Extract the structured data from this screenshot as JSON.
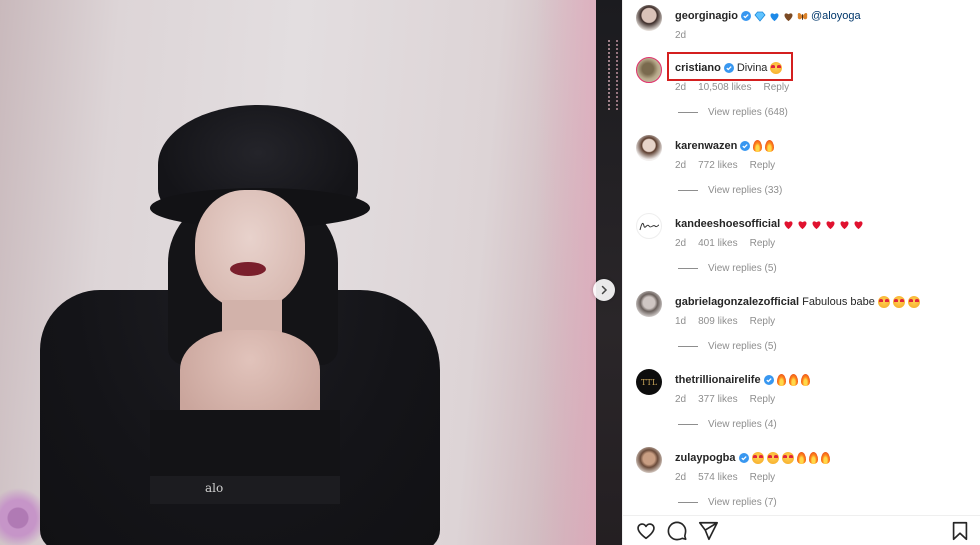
{
  "photo": {
    "logo_text": "alo"
  },
  "nav": {
    "next_icon": "chevron-right-icon"
  },
  "comments": [
    {
      "username": "georginagio",
      "verified": true,
      "text": "",
      "mention": "@aloyoga",
      "emoji": [
        "blue-diamond",
        "blue-heart",
        "brown-heart",
        "butterfly"
      ],
      "time": "2d",
      "likes": "",
      "reply_label": "",
      "view_replies": ""
    },
    {
      "username": "cristiano",
      "verified": true,
      "text": "Divina",
      "emoji": [
        "smiling-face-with-hearts"
      ],
      "time": "2d",
      "likes": "10,508 likes",
      "reply_label": "Reply",
      "view_replies": "View replies (648)",
      "highlighted": true
    },
    {
      "username": "karenwazen",
      "verified": true,
      "text": "",
      "emoji": [
        "fire",
        "fire"
      ],
      "time": "2d",
      "likes": "772 likes",
      "reply_label": "Reply",
      "view_replies": "View replies (33)"
    },
    {
      "username": "kandeeshoesofficial",
      "verified": false,
      "text": "",
      "emoji": [
        "red-heart",
        "red-heart",
        "red-heart",
        "red-heart",
        "red-heart",
        "red-heart"
      ],
      "time": "2d",
      "likes": "401 likes",
      "reply_label": "Reply",
      "view_replies": "View replies (5)"
    },
    {
      "username": "gabrielagonzalezofficial",
      "verified": false,
      "text": "Fabulous babe",
      "emoji": [
        "heart-eyes",
        "heart-eyes",
        "heart-eyes"
      ],
      "time": "1d",
      "likes": "809 likes",
      "reply_label": "Reply",
      "view_replies": "View replies (5)"
    },
    {
      "username": "thetrillionairelife",
      "verified": true,
      "text": "",
      "emoji": [
        "fire",
        "fire",
        "fire"
      ],
      "time": "2d",
      "likes": "377 likes",
      "reply_label": "Reply",
      "view_replies": "View replies (4)"
    },
    {
      "username": "zulaypogba",
      "verified": true,
      "text": "",
      "emoji": [
        "heart-eyes",
        "heart-eyes",
        "heart-eyes",
        "fire",
        "fire",
        "fire"
      ],
      "time": "2d",
      "likes": "574 likes",
      "reply_label": "Reply",
      "view_replies": "View replies (7)"
    }
  ],
  "actions": [
    "like-icon",
    "comment-icon",
    "share-icon",
    "save-icon"
  ],
  "colors": {
    "verified_blue": "#3897f0",
    "highlight_red": "#d41f1f",
    "muted": "#8e8e8e",
    "mention": "#00376b"
  }
}
